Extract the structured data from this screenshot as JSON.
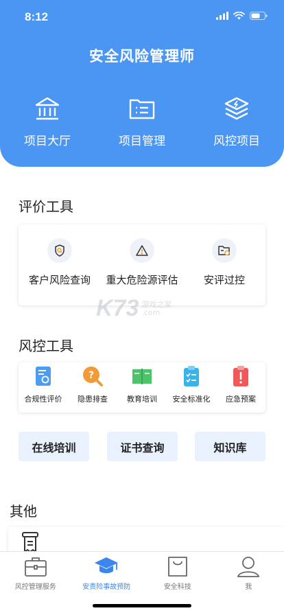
{
  "status": {
    "time": "8:12"
  },
  "header": {
    "title": "安全风险管理师",
    "nav": [
      {
        "label": "项目大厅",
        "icon": "building-icon"
      },
      {
        "label": "项目管理",
        "icon": "folder-list-icon"
      },
      {
        "label": "风控项目",
        "icon": "layers-icon"
      }
    ]
  },
  "evaluation": {
    "title": "评价工具",
    "items": [
      {
        "label": "客户风险查询",
        "icon": "shield-search-icon"
      },
      {
        "label": "重大危险源评估",
        "icon": "warning-triangle-icon"
      },
      {
        "label": "安评过控",
        "icon": "folder-check-icon"
      }
    ]
  },
  "risk_tools": {
    "title": "风控工具",
    "items": [
      {
        "label": "合规性评价",
        "icon": "compliance-doc-icon",
        "color": "#4c9cf0"
      },
      {
        "label": "隐患排查",
        "icon": "question-search-icon",
        "color": "#f29a38"
      },
      {
        "label": "教育培训",
        "icon": "book-icon",
        "color": "#4dc36a"
      },
      {
        "label": "安全标准化",
        "icon": "clipboard-check-icon",
        "color": "#39b3e8"
      },
      {
        "label": "应急预案",
        "icon": "clipboard-alert-icon",
        "color": "#f0585a"
      }
    ]
  },
  "quick_links": [
    {
      "label": "在线培训"
    },
    {
      "label": "证书查询"
    },
    {
      "label": "知识库"
    }
  ],
  "other": {
    "title": "其他"
  },
  "watermark": {
    "logo": "K73",
    "line1": "游戏之家",
    "line2": ".com"
  },
  "tabbar": {
    "tabs": [
      {
        "label": "风控管理服务",
        "icon": "briefcase-icon",
        "active": false
      },
      {
        "label": "安责险事故预防",
        "icon": "graduation-cap-icon",
        "active": true
      },
      {
        "label": "安全科技",
        "icon": "shopping-bag-icon",
        "active": false
      },
      {
        "label": "我",
        "icon": "user-icon",
        "active": false
      }
    ]
  },
  "colors": {
    "brand": "#4b96f3",
    "tab_active": "#3a86ee",
    "quick_bg": "#e8f1fc"
  }
}
